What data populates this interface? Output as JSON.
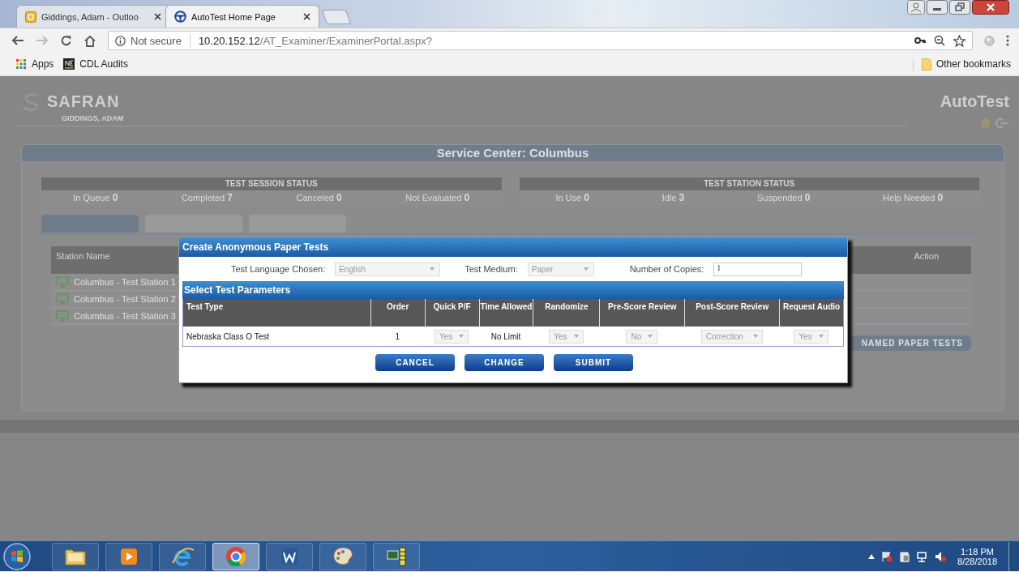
{
  "browser": {
    "tabs": [
      {
        "title": "Giddings, Adam - Outloo",
        "kind": "outlook",
        "selected": false
      },
      {
        "title": "AutoTest Home Page",
        "kind": "autotest",
        "selected": true
      }
    ],
    "address": {
      "security": "Not secure",
      "host": "10.20.152.12",
      "path": "/AT_Examiner/ExaminerPortal.aspx?"
    },
    "bookmarks": [
      {
        "label": "Apps",
        "kind": "apps"
      },
      {
        "label": "CDL Audits",
        "kind": "ne"
      }
    ],
    "other_bookmarks": "Other bookmarks"
  },
  "background_page": {
    "brand": "SAFRAN",
    "user": "GIDDINGS, ADAM",
    "product": "AutoTest",
    "panel_title": "Service Center: Columbus",
    "status_groups": [
      {
        "title": "TEST SESSION STATUS",
        "items": [
          {
            "label": "In Queue",
            "value": "0"
          },
          {
            "label": "Completed",
            "value": "7"
          },
          {
            "label": "Canceled",
            "value": "0"
          },
          {
            "label": "Not Evaluated",
            "value": "0"
          }
        ]
      },
      {
        "title": "TEST STATION STATUS",
        "items": [
          {
            "label": "In Use",
            "value": "0"
          },
          {
            "label": "Idle",
            "value": "3"
          },
          {
            "label": "Suspended",
            "value": "0"
          },
          {
            "label": "Help Needed",
            "value": "0"
          }
        ]
      }
    ],
    "table_columns": [
      "Station Name",
      "Action"
    ],
    "stations": [
      "Columbus - Test Station 1",
      "Columbus - Test Station 2",
      "Columbus - Test Station 3"
    ],
    "partial_button": "NAMED PAPER TESTS"
  },
  "dialog": {
    "title": "Create Anonymous Paper Tests",
    "fields": [
      {
        "label": "Test Language Chosen:",
        "value": "English",
        "kind": "select"
      },
      {
        "label": "Test Medium:",
        "value": "Paper",
        "kind": "select"
      },
      {
        "label": "Number of Copies:",
        "value": "1",
        "kind": "input"
      }
    ],
    "section_title": "Select Test Parameters",
    "columns": [
      "Test Type",
      "Order",
      "Quick P/F",
      "Time Allowed",
      "Randomize",
      "Pre-Score Review",
      "Post-Score Review",
      "Request Audio"
    ],
    "rows": [
      {
        "cells": [
          {
            "kind": "text",
            "value": "Nebraska Class O Test"
          },
          {
            "kind": "text",
            "value": "1"
          },
          {
            "kind": "select",
            "value": "Yes"
          },
          {
            "kind": "text",
            "value": "No Limit"
          },
          {
            "kind": "select",
            "value": "Yes"
          },
          {
            "kind": "select",
            "value": "No"
          },
          {
            "kind": "select",
            "value": "Correction"
          },
          {
            "kind": "select",
            "value": "Yes"
          }
        ]
      }
    ],
    "buttons": [
      "CANCEL",
      "CHANGE",
      "SUBMIT"
    ]
  },
  "taskbar": {
    "apps": [
      {
        "kind": "explorer",
        "selected": false
      },
      {
        "kind": "media",
        "selected": false
      },
      {
        "kind": "ie",
        "selected": false
      },
      {
        "kind": "chrome",
        "selected": true
      },
      {
        "kind": "word",
        "selected": false
      },
      {
        "kind": "paint",
        "selected": false
      },
      {
        "kind": "monitor",
        "selected": false
      }
    ],
    "clock": {
      "time": "1:18 PM",
      "date": "8/28/2018"
    }
  }
}
